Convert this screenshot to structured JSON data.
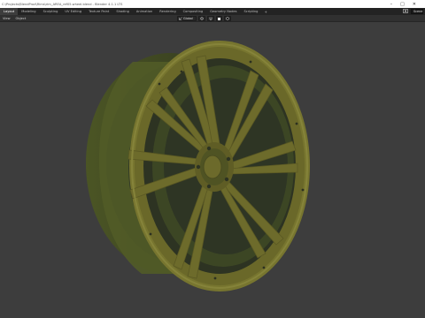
{
  "window": {
    "title": "C:\\Projects\\BlendProd\\Rims\\rim_AREA_ref05.wheel.blend - Blender 4.1.1 LTS",
    "controls": [
      "–",
      "□",
      "✕"
    ]
  },
  "menubar": {
    "tabs": [
      "Layout",
      "Modeling",
      "Sculpting",
      "UV Editing",
      "Texture Paint",
      "Shading",
      "Animation",
      "Rendering",
      "Compositing",
      "Geometry Nodes",
      "Scripting"
    ],
    "active_tab": "Layout",
    "add_label": "+",
    "scene_label": "Scene"
  },
  "toolbar": {
    "menu_items": [
      "View",
      "Object"
    ],
    "transform_orientation": "Global",
    "pivot_icon": "pivot-icon",
    "snap_icon": "snap-icon",
    "proportional_icon": "proportional-icon"
  },
  "viewport": {
    "background": "#3d3d3d",
    "wheel_color": "#6f6d2b",
    "wheel_shadow": "#2f3320"
  }
}
